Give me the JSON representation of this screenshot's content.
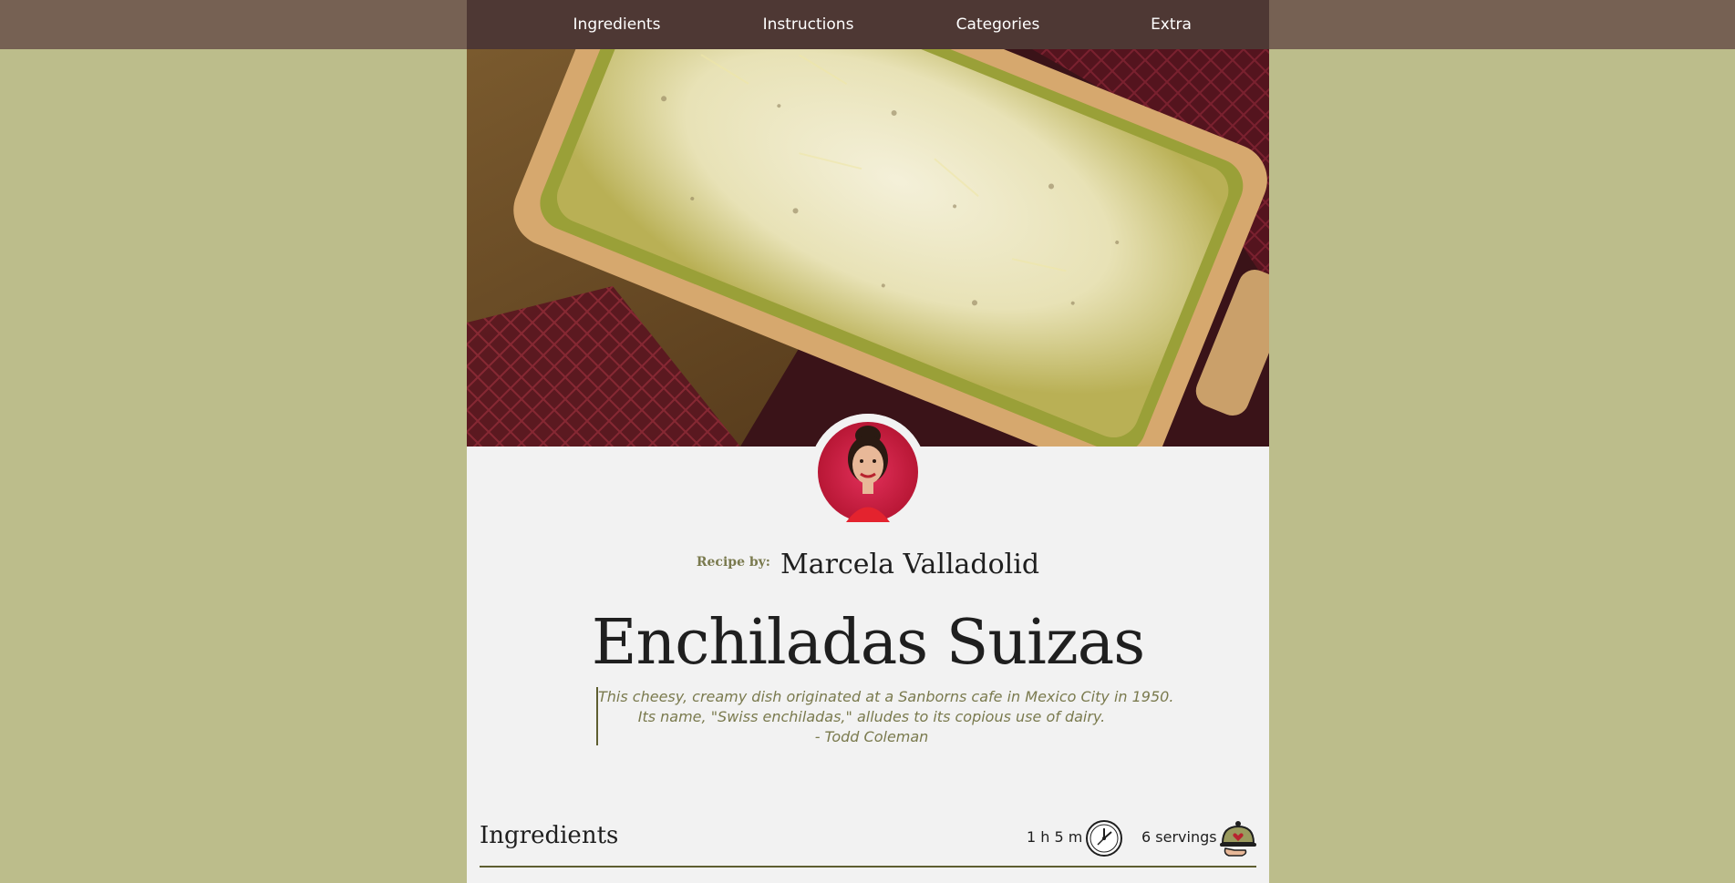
{
  "nav": {
    "items": [
      {
        "label": "Ingredients"
      },
      {
        "label": "Instructions"
      },
      {
        "label": "Categories"
      },
      {
        "label": "Extra"
      }
    ]
  },
  "recipe": {
    "by_label": "Recipe by:",
    "author": "Marcela Valladolid",
    "title": "Enchiladas Suizas",
    "quote_lines": [
      "This cheesy, creamy dish originated at a Sanborns cafe in Mexico City in 1950.",
      "Its name, \"Swiss enchiladas,\" alludes to its copious use of dairy.",
      "- Todd Coleman"
    ]
  },
  "ingredients_section": {
    "heading": "Ingredients",
    "time": "1 h 5 m",
    "servings": "6 servings"
  },
  "colors": {
    "page_background": "#BCBD8B",
    "topbar": "#766153",
    "navbar": "#4E3834",
    "content_background": "#F2F2F2",
    "accent_olive": "#7A7A4E"
  },
  "icons": {
    "time": "clock-icon",
    "servings": "cloche-icon"
  }
}
